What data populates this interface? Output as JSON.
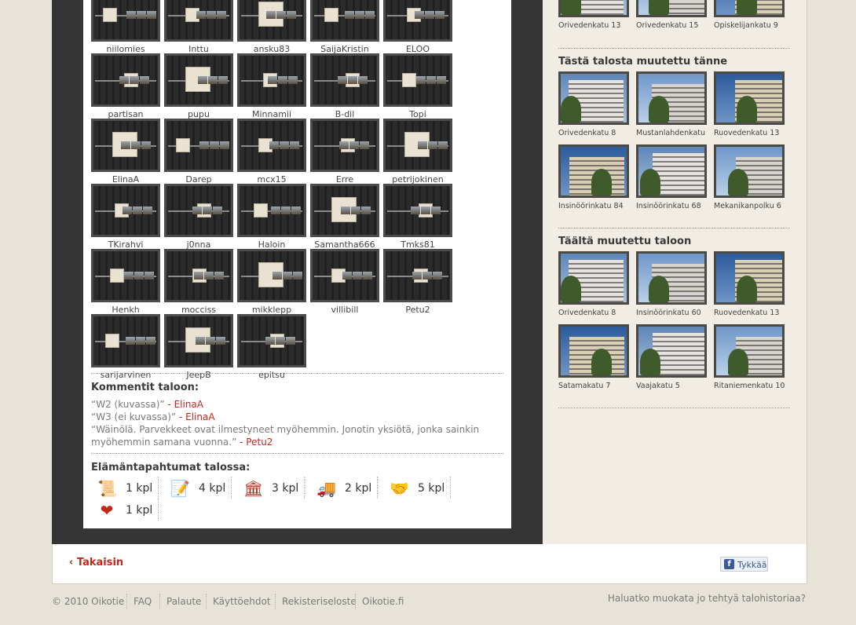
{
  "users": [
    {
      "name": "niilomies"
    },
    {
      "name": "Inttu"
    },
    {
      "name": "ansku83"
    },
    {
      "name": "SaijaKristin"
    },
    {
      "name": "ELOO"
    },
    {
      "name": "partisan"
    },
    {
      "name": "pupu"
    },
    {
      "name": "Minnamii"
    },
    {
      "name": "B-dil"
    },
    {
      "name": "Topi"
    },
    {
      "name": "ElinaA"
    },
    {
      "name": "Darep"
    },
    {
      "name": "mcx15"
    },
    {
      "name": "Erre"
    },
    {
      "name": "petrijokinen"
    },
    {
      "name": "TKirahvi"
    },
    {
      "name": "j0nna"
    },
    {
      "name": "Haloin"
    },
    {
      "name": "Samantha666"
    },
    {
      "name": "Tmks81"
    },
    {
      "name": "Henkh"
    },
    {
      "name": "mocciss"
    },
    {
      "name": "mikklepp"
    },
    {
      "name": "villibill"
    },
    {
      "name": "Petu2"
    },
    {
      "name": "sarijarvinen"
    },
    {
      "name": "JeepB"
    },
    {
      "name": "epitsu"
    }
  ],
  "comments": {
    "heading": "Kommentit taloon:",
    "items": [
      {
        "text": "“W2 (kuvassa)”",
        "sep": " - ",
        "author": "ElinaA"
      },
      {
        "text": "“W3 (ei kuvassa)”",
        "sep": " - ",
        "author": "ElinaA"
      },
      {
        "text": "“Wäinölä. Parvekkeet ovat ilmestyneet myöhemmin. Jonotin yksiötä, jonka sainkin myöhemmin samana vuonna.”",
        "sep": " - ",
        "author": "Petu2"
      }
    ]
  },
  "events": {
    "heading": "Elämäntapahtumat talossa:",
    "items": [
      {
        "icon": "certificate-icon",
        "glyph": "📜",
        "count": "1 kpl"
      },
      {
        "icon": "document-pen-icon",
        "glyph": "📝",
        "count": "4 kpl"
      },
      {
        "icon": "pillar-icon",
        "glyph": "🏛",
        "count": "3 kpl"
      },
      {
        "icon": "moving-truck-icon",
        "glyph": "🚚",
        "count": "2 kpl"
      },
      {
        "icon": "handshake-icon",
        "glyph": "🤝",
        "count": "5 kpl"
      },
      {
        "icon": "heart-icon",
        "glyph": "❤",
        "count": "1 kpl"
      }
    ]
  },
  "sidebar": {
    "top_row": [
      {
        "label": "Orivedenkatu 13"
      },
      {
        "label": "Orivedenkatu 15"
      },
      {
        "label": "Opiskelijankatu 9"
      }
    ],
    "moved_here": {
      "heading": "Tästä talosta muutettu tänne",
      "items": [
        {
          "label": "Orivedenkatu 8"
        },
        {
          "label": "Mustanlahdenkatu"
        },
        {
          "label": "Ruovedenkatu 13"
        },
        {
          "label": "Insinöörinkatu 84"
        },
        {
          "label": "Insinöörinkatu 68"
        },
        {
          "label": "Mekanikanpolku 6"
        }
      ]
    },
    "moved_from": {
      "heading": "Täältä muutettu taloon",
      "items": [
        {
          "label": "Orivedenkatu 8"
        },
        {
          "label": "Insinöörinkatu 60"
        },
        {
          "label": "Ruovedenkatu 13"
        },
        {
          "label": "Satamakatu 7"
        },
        {
          "label": "Vaajakatu 5"
        },
        {
          "label": "Ritaniemenkatu 10"
        }
      ]
    }
  },
  "nav": {
    "back_label": "‹ Takaisin",
    "like_label": "Tykkää",
    "fb_glyph": "f"
  },
  "footer": {
    "copyright": "© 2010 Oikotie",
    "links": [
      "FAQ",
      "Palaute",
      "Käyttöehdot",
      "Rekisteriseloste",
      "Oikotie.fi"
    ],
    "right_text": "Haluatko muokata jo tehtyä talohistoriaa?"
  },
  "colors": {
    "accent": "#c0281c",
    "dark_panel": "#353535",
    "sidebar_bg": "#f1ede4",
    "page_bg": "#e8e3d8"
  }
}
